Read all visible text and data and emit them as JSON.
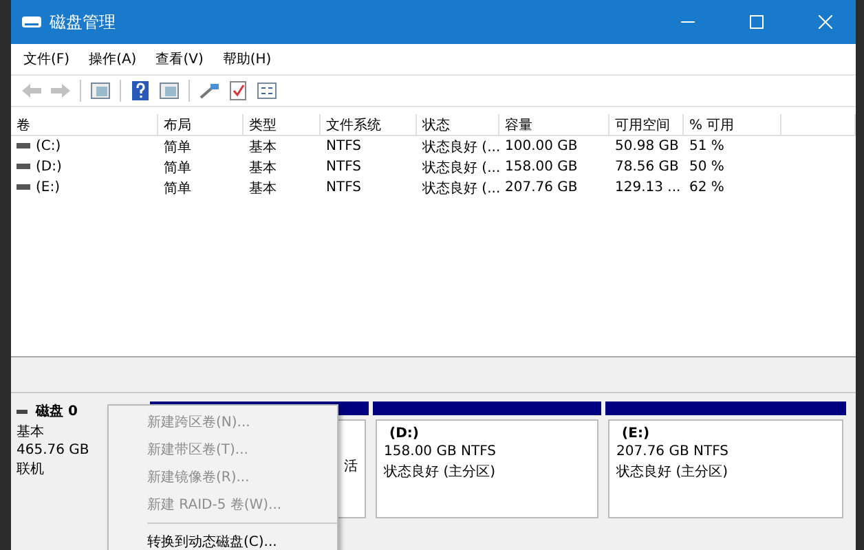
{
  "window": {
    "title": "磁盘管理"
  },
  "menu": [
    "文件(F)",
    "操作(A)",
    "查看(V)",
    "帮助(H)"
  ],
  "toolbar": [
    {
      "kind": "back",
      "disabled": true
    },
    {
      "kind": "forward",
      "disabled": true
    },
    {
      "kind": "sep"
    },
    {
      "kind": "pane",
      "disabled": false
    },
    {
      "kind": "sep"
    },
    {
      "kind": "help",
      "disabled": false
    },
    {
      "kind": "pane",
      "disabled": false
    },
    {
      "kind": "sep"
    },
    {
      "kind": "wand",
      "disabled": false
    },
    {
      "kind": "check",
      "disabled": false
    },
    {
      "kind": "props",
      "disabled": false
    }
  ],
  "table": {
    "columns": [
      "卷",
      "布局",
      "类型",
      "文件系统",
      "状态",
      "容量",
      "可用空间",
      "% 可用"
    ],
    "rows": [
      [
        "(C:)",
        "简单",
        "基本",
        "NTFS",
        "状态良好 (...",
        "100.00 GB",
        "50.98 GB",
        "51 %"
      ],
      [
        "(D:)",
        "简单",
        "基本",
        "NTFS",
        "状态良好 (...",
        "158.00 GB",
        "78.56 GB",
        "50 %"
      ],
      [
        "(E:)",
        "简单",
        "基本",
        "NTFS",
        "状态良好 (...",
        "207.76 GB",
        "129.13 ...",
        "62 %"
      ]
    ]
  },
  "disk": {
    "name": "磁盘 0",
    "type": "基本",
    "size": "465.76 GB",
    "status": "联机"
  },
  "partitions": [
    {
      "tail": "活"
    },
    {
      "name": "(D:)",
      "lines": [
        "158.00 GB NTFS",
        "状态良好 (主分区)"
      ]
    },
    {
      "name": "(E:)",
      "lines": [
        "207.76 GB NTFS",
        "状态良好 (主分区)"
      ]
    }
  ],
  "context_menu": [
    {
      "kind": "item",
      "label": "新建跨区卷(N)...",
      "disabled": true
    },
    {
      "kind": "item",
      "label": "新建带区卷(T)...",
      "disabled": true
    },
    {
      "kind": "item",
      "label": "新建镜像卷(R)...",
      "disabled": true
    },
    {
      "kind": "item",
      "label": "新建 RAID-5 卷(W)...",
      "disabled": true
    },
    {
      "kind": "separator"
    },
    {
      "kind": "item",
      "label": "转换到动态磁盘(C)...",
      "disabled": false
    }
  ]
}
